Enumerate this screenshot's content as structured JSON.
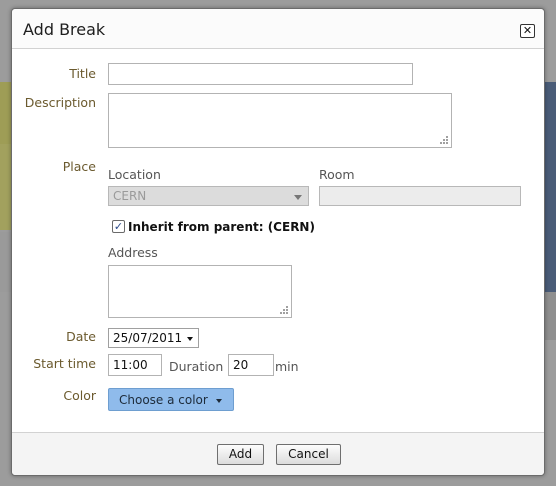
{
  "dialog": {
    "title": "Add Break"
  },
  "fields": {
    "title_label": "Title",
    "title_value": "",
    "description_label": "Description",
    "description_value": "",
    "place_label": "Place",
    "location_label": "Location",
    "location_value": "CERN",
    "room_label": "Room",
    "room_value": "",
    "inherit_label": "Inherit from parent: (CERN)",
    "inherit_checked": true,
    "address_label": "Address",
    "address_value": "",
    "date_label": "Date",
    "date_value": "25/07/2011",
    "start_time_label": "Start time",
    "start_time_value": "11:00",
    "duration_label": "Duration",
    "duration_value": "20",
    "duration_unit": "min",
    "color_label": "Color",
    "color_button": "Choose a color"
  },
  "buttons": {
    "add": "Add",
    "cancel": "Cancel",
    "close": "✕"
  },
  "colors": {
    "label": "#6b5a2e",
    "color_button": "#8fbbeb"
  }
}
